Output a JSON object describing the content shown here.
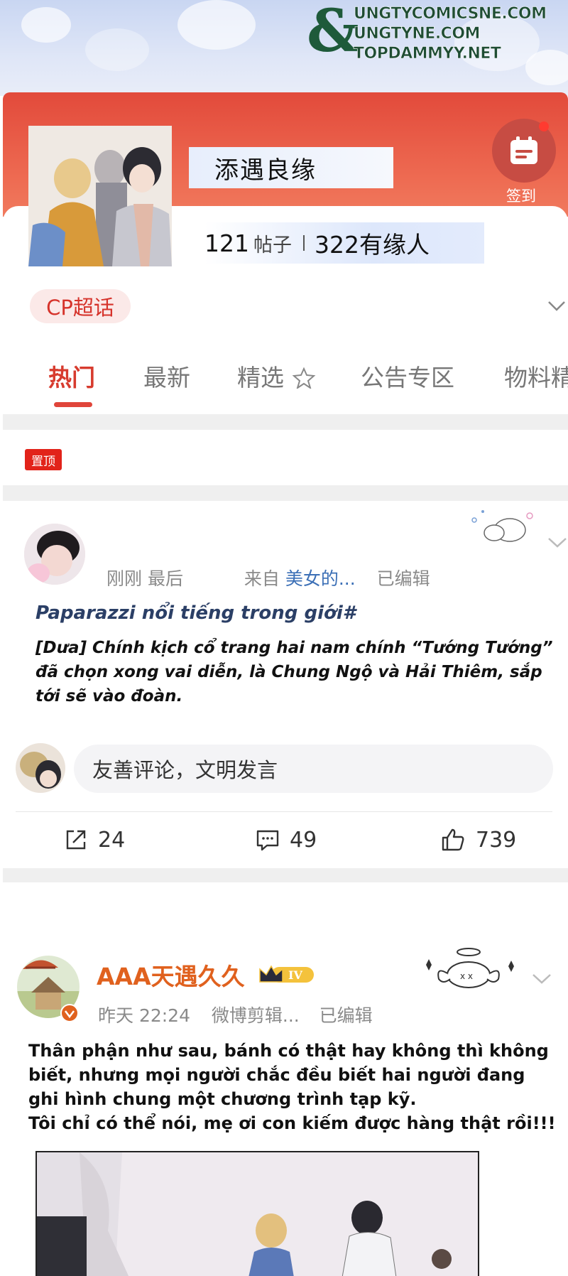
{
  "watermark": {
    "lines": [
      "UNGTYCOMICSNE.COM",
      "UNGTYNE.COM",
      "TOPDAMMYY.NET"
    ]
  },
  "forum": {
    "title": "添遇良缘",
    "posts_count": "121",
    "posts_unit": "帖子",
    "members": "322有缘人",
    "signin_label": "签到",
    "tag": "CP超话"
  },
  "tabs": [
    {
      "label": "热门",
      "active": true
    },
    {
      "label": "最新"
    },
    {
      "label": "精选"
    },
    {
      "label": "公告专区"
    },
    {
      "label": "物料精"
    }
  ],
  "pinned_label": "置顶",
  "post1": {
    "time": "刚刚 最后",
    "from_label": "来自",
    "source": "美女的...",
    "edited": "已编辑",
    "hashtag": "Paparazzi nổi tiếng trong giới#",
    "text": "[Dưa] Chính kịch cổ trang hai nam chính “Tướng Tướng” đã chọn xong vai diễn, là Chung Ngộ và Hải Thiêm, sắp tới sẽ vào đoàn.",
    "comment_placeholder": "友善评论，文明发言",
    "shares": "24",
    "comments": "49",
    "likes": "739"
  },
  "post2": {
    "author": "AAA天遇久久",
    "level": "IV",
    "time": "昨天 22:24",
    "source": "微博剪辑...",
    "edited": "已编辑",
    "text_line1": "Thân phận như sau, bánh có thật hay không thì không biết, nhưng mọi người chắc đều biết hai người đang ghi hình chung một chương trình tạp kỹ.",
    "text_line2": "Tôi chỉ có thể nói, mẹ ơi con kiếm được hàng thật rồi!!!"
  },
  "colors": {
    "accent": "#e0453a",
    "header": "#e24a3b",
    "link": "#3b6fb6",
    "author": "#e0611e"
  },
  "icons": [
    "calendar-signin-icon",
    "chevron-down-icon",
    "share-icon",
    "comment-icon",
    "like-icon",
    "crown-icon"
  ]
}
